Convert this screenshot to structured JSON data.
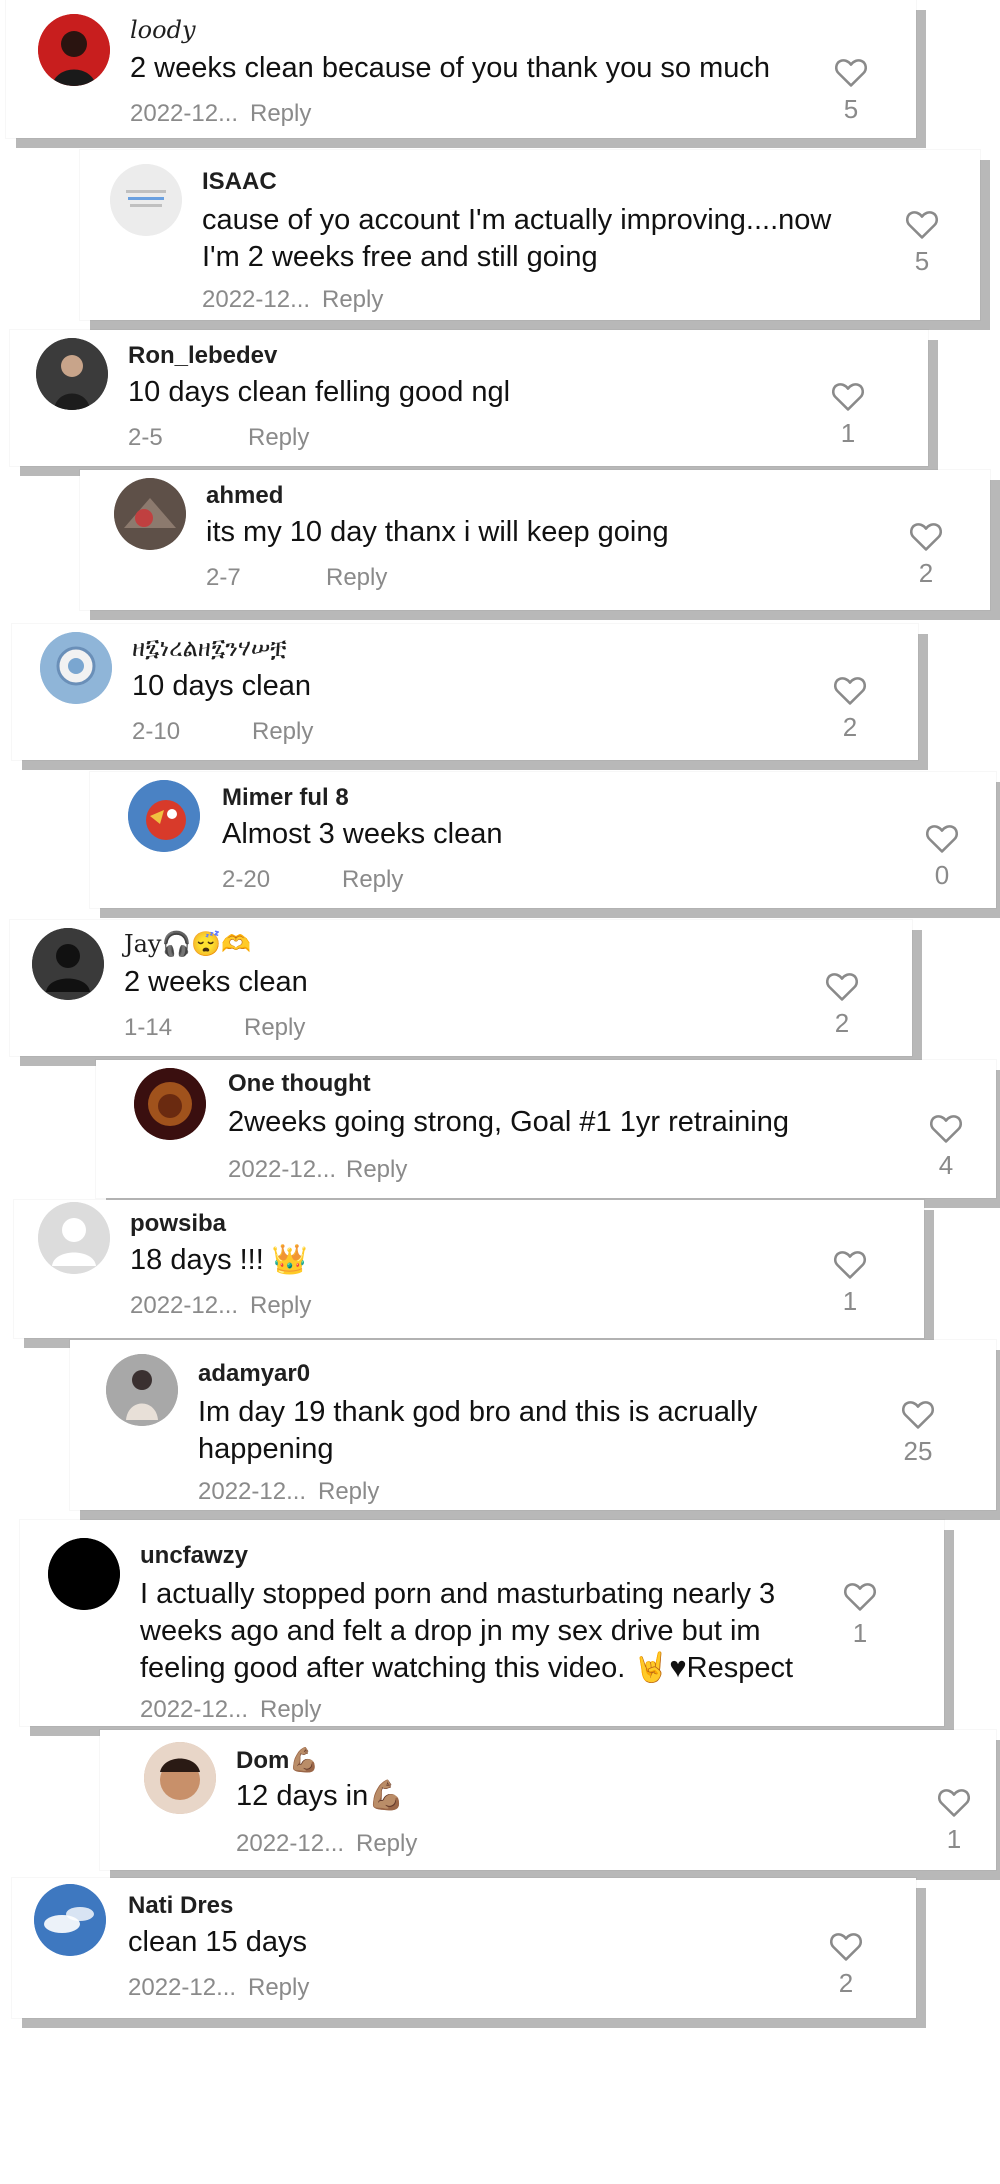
{
  "comments": [
    {
      "username": "loody",
      "text": "2 weeks clean because of you thank you so much",
      "date": "2022-12...",
      "reply": "Reply",
      "likes": "5",
      "avatar": "red-figure-avatar"
    },
    {
      "username": "ISAAC",
      "text": "cause of yo account I'm actually improving....now\nI'm 2 weeks free and still going",
      "date": "2022-12...",
      "reply": "Reply",
      "likes": "5",
      "avatar": "text-note-avatar"
    },
    {
      "username": "Ron_lebedev",
      "text": "10 days clean felling good ngl",
      "date": "2-5",
      "reply": "Reply",
      "likes": "1",
      "avatar": "dark-photo-avatar"
    },
    {
      "username": "ahmed",
      "text": "its my 10 day thanx i will keep going",
      "date": "2-7",
      "reply": "Reply",
      "likes": "2",
      "avatar": "sports-photo-avatar"
    },
    {
      "username": "ዘ፯ነረልዘ፯ንሃሠቿ",
      "text": "10 days clean",
      "date": "2-10",
      "reply": "Reply",
      "likes": "2",
      "avatar": "club-crest-avatar"
    },
    {
      "username": "Mimer ful 8",
      "text": "Almost 3 weeks clean",
      "date": "2-20",
      "reply": "Reply",
      "likes": "0",
      "avatar": "cartoon-bird-avatar"
    },
    {
      "username": "Jay🎧😴🫶",
      "text": "2 weeks clean",
      "date": "1-14",
      "reply": "Reply",
      "likes": "2",
      "avatar": "default-dark-avatar"
    },
    {
      "username": "One thought",
      "text": "2weeks going strong, Goal #1 1yr retraining",
      "date": "2022-12...",
      "reply": "Reply",
      "likes": "4",
      "avatar": "lion-avatar"
    },
    {
      "username": "powsiba",
      "text": "18 days !!! 👑",
      "date": "2022-12...",
      "reply": "Reply",
      "likes": "1",
      "avatar": "default-light-avatar"
    },
    {
      "username": "adamyar0",
      "text": "Im day 19 thank god bro and this is acrually\nhappening",
      "date": "2022-12...",
      "reply": "Reply",
      "likes": "25",
      "avatar": "mirror-selfie-avatar"
    },
    {
      "username": "uncfawzy",
      "text": "I actually stopped porn and masturbating nearly 3\nweeks ago and felt a drop jn my sex drive but im\nfeeling good after watching this video. 🤘♥Respect",
      "date": "2022-12...",
      "reply": "Reply",
      "likes": "1",
      "avatar": "black-circle-avatar"
    },
    {
      "username": "Dom💪🏽",
      "text": "12 days in💪🏽",
      "date": "2022-12...",
      "reply": "Reply",
      "likes": "1",
      "avatar": "face-photo-avatar"
    },
    {
      "username": "Nati Dres",
      "text": "clean 15 days",
      "date": "2022-12...",
      "reply": "Reply",
      "likes": "2",
      "avatar": "sky-clouds-avatar"
    }
  ],
  "icons": {
    "like": "heart-outline-icon"
  },
  "colors": {
    "meta_gray": "#8a8a8a",
    "text": "#111111",
    "shadow": "#9a9a9a"
  }
}
